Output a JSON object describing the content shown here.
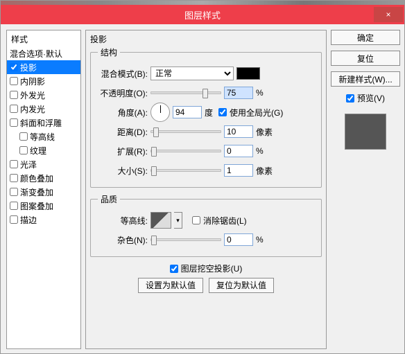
{
  "window": {
    "title": "图层样式",
    "close": "×"
  },
  "styles": {
    "header": "样式",
    "items": [
      {
        "label": "混合选项·默认",
        "checkbox": false
      },
      {
        "label": "投影",
        "checkbox": true,
        "checked": true,
        "selected": true
      },
      {
        "label": "内阴影",
        "checkbox": true,
        "checked": false
      },
      {
        "label": "外发光",
        "checkbox": true,
        "checked": false
      },
      {
        "label": "内发光",
        "checkbox": true,
        "checked": false
      },
      {
        "label": "斜面和浮雕",
        "checkbox": true,
        "checked": false
      },
      {
        "label": "等高线",
        "checkbox": true,
        "checked": false,
        "indent": true
      },
      {
        "label": "纹理",
        "checkbox": true,
        "checked": false,
        "indent": true
      },
      {
        "label": "光泽",
        "checkbox": true,
        "checked": false
      },
      {
        "label": "颜色叠加",
        "checkbox": true,
        "checked": false
      },
      {
        "label": "渐变叠加",
        "checkbox": true,
        "checked": false
      },
      {
        "label": "图案叠加",
        "checkbox": true,
        "checked": false
      },
      {
        "label": "描边",
        "checkbox": true,
        "checked": false
      }
    ]
  },
  "settings": {
    "title": "投影",
    "structure_legend": "结构",
    "blend_mode_label": "混合模式(B):",
    "blend_mode_value": "正常",
    "color": "#000000",
    "opacity_label": "不透明度(O):",
    "opacity_value": "75",
    "percent": "%",
    "angle_label": "角度(A):",
    "angle_value": "94",
    "angle_unit": "度",
    "global_light_label": "使用全局光(G)",
    "global_light_checked": true,
    "distance_label": "距离(D):",
    "distance_value": "10",
    "px": "像素",
    "spread_label": "扩展(R):",
    "spread_value": "0",
    "size_label": "大小(S):",
    "size_value": "1",
    "quality_legend": "品质",
    "contour_label": "等高线:",
    "antialias_label": "消除锯齿(L)",
    "antialias_checked": false,
    "noise_label": "杂色(N):",
    "noise_value": "0",
    "knockout_label": "图层挖空投影(U)",
    "knockout_checked": true,
    "set_default": "设置为默认值",
    "reset_default": "复位为默认值"
  },
  "side": {
    "ok": "确定",
    "cancel": "复位",
    "new_style": "新建样式(W)...",
    "preview_label": "预览(V)",
    "preview_checked": true
  }
}
